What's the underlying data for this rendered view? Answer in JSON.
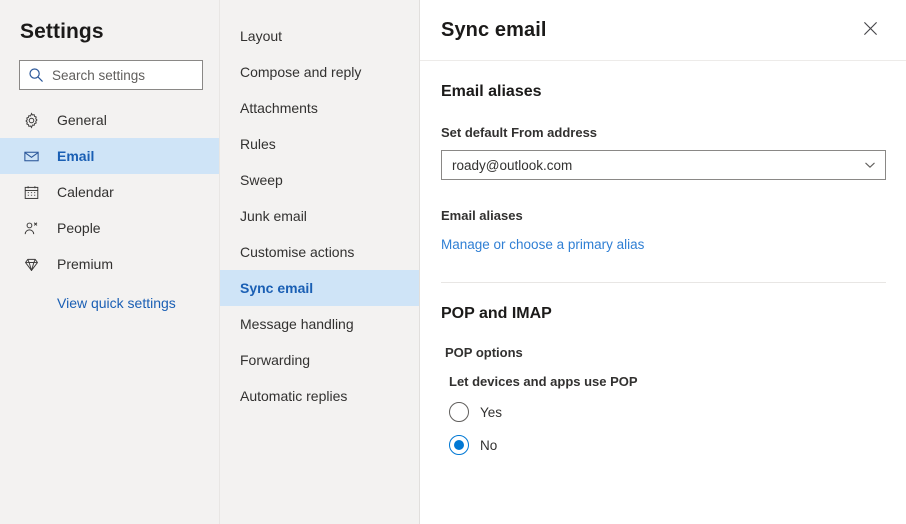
{
  "sidebar": {
    "title": "Settings",
    "search": {
      "placeholder": "Search settings",
      "value": "",
      "icon": "search-icon"
    },
    "items": [
      {
        "label": "General",
        "icon": "gear-icon",
        "selected": false
      },
      {
        "label": "Email",
        "icon": "envelope-icon",
        "selected": true
      },
      {
        "label": "Calendar",
        "icon": "calendar-icon",
        "selected": false
      },
      {
        "label": "People",
        "icon": "people-icon",
        "selected": false
      },
      {
        "label": "Premium",
        "icon": "diamond-icon",
        "selected": false
      }
    ],
    "quick_link": "View quick settings"
  },
  "midnav": {
    "items": [
      {
        "label": "Layout",
        "selected": false
      },
      {
        "label": "Compose and reply",
        "selected": false
      },
      {
        "label": "Attachments",
        "selected": false
      },
      {
        "label": "Rules",
        "selected": false
      },
      {
        "label": "Sweep",
        "selected": false
      },
      {
        "label": "Junk email",
        "selected": false
      },
      {
        "label": "Customise actions",
        "selected": false
      },
      {
        "label": "Sync email",
        "selected": true
      },
      {
        "label": "Message handling",
        "selected": false
      },
      {
        "label": "Forwarding",
        "selected": false
      },
      {
        "label": "Automatic replies",
        "selected": false
      }
    ]
  },
  "content": {
    "title": "Sync email",
    "close_icon": "close-icon",
    "aliases_heading": "Email aliases",
    "from_address_label": "Set default From address",
    "from_address_value": "roady@outlook.com",
    "from_address_chevron": "chevron-down-icon",
    "aliases_sub_label": "Email aliases",
    "manage_alias_link": "Manage or choose a primary alias",
    "pop_imap_heading": "POP and IMAP",
    "pop_options_label": "POP options",
    "pop_question": "Let devices and apps use POP",
    "radios": [
      {
        "label": "Yes",
        "checked": false
      },
      {
        "label": "No",
        "checked": true
      }
    ]
  },
  "colors": {
    "accent": "#0078d4",
    "link": "#2f7fd4",
    "selected_bg": "#cfe4f7",
    "selected_text": "#1a5fb4",
    "panel_bg": "#f3f2f1",
    "text": "#323130"
  }
}
